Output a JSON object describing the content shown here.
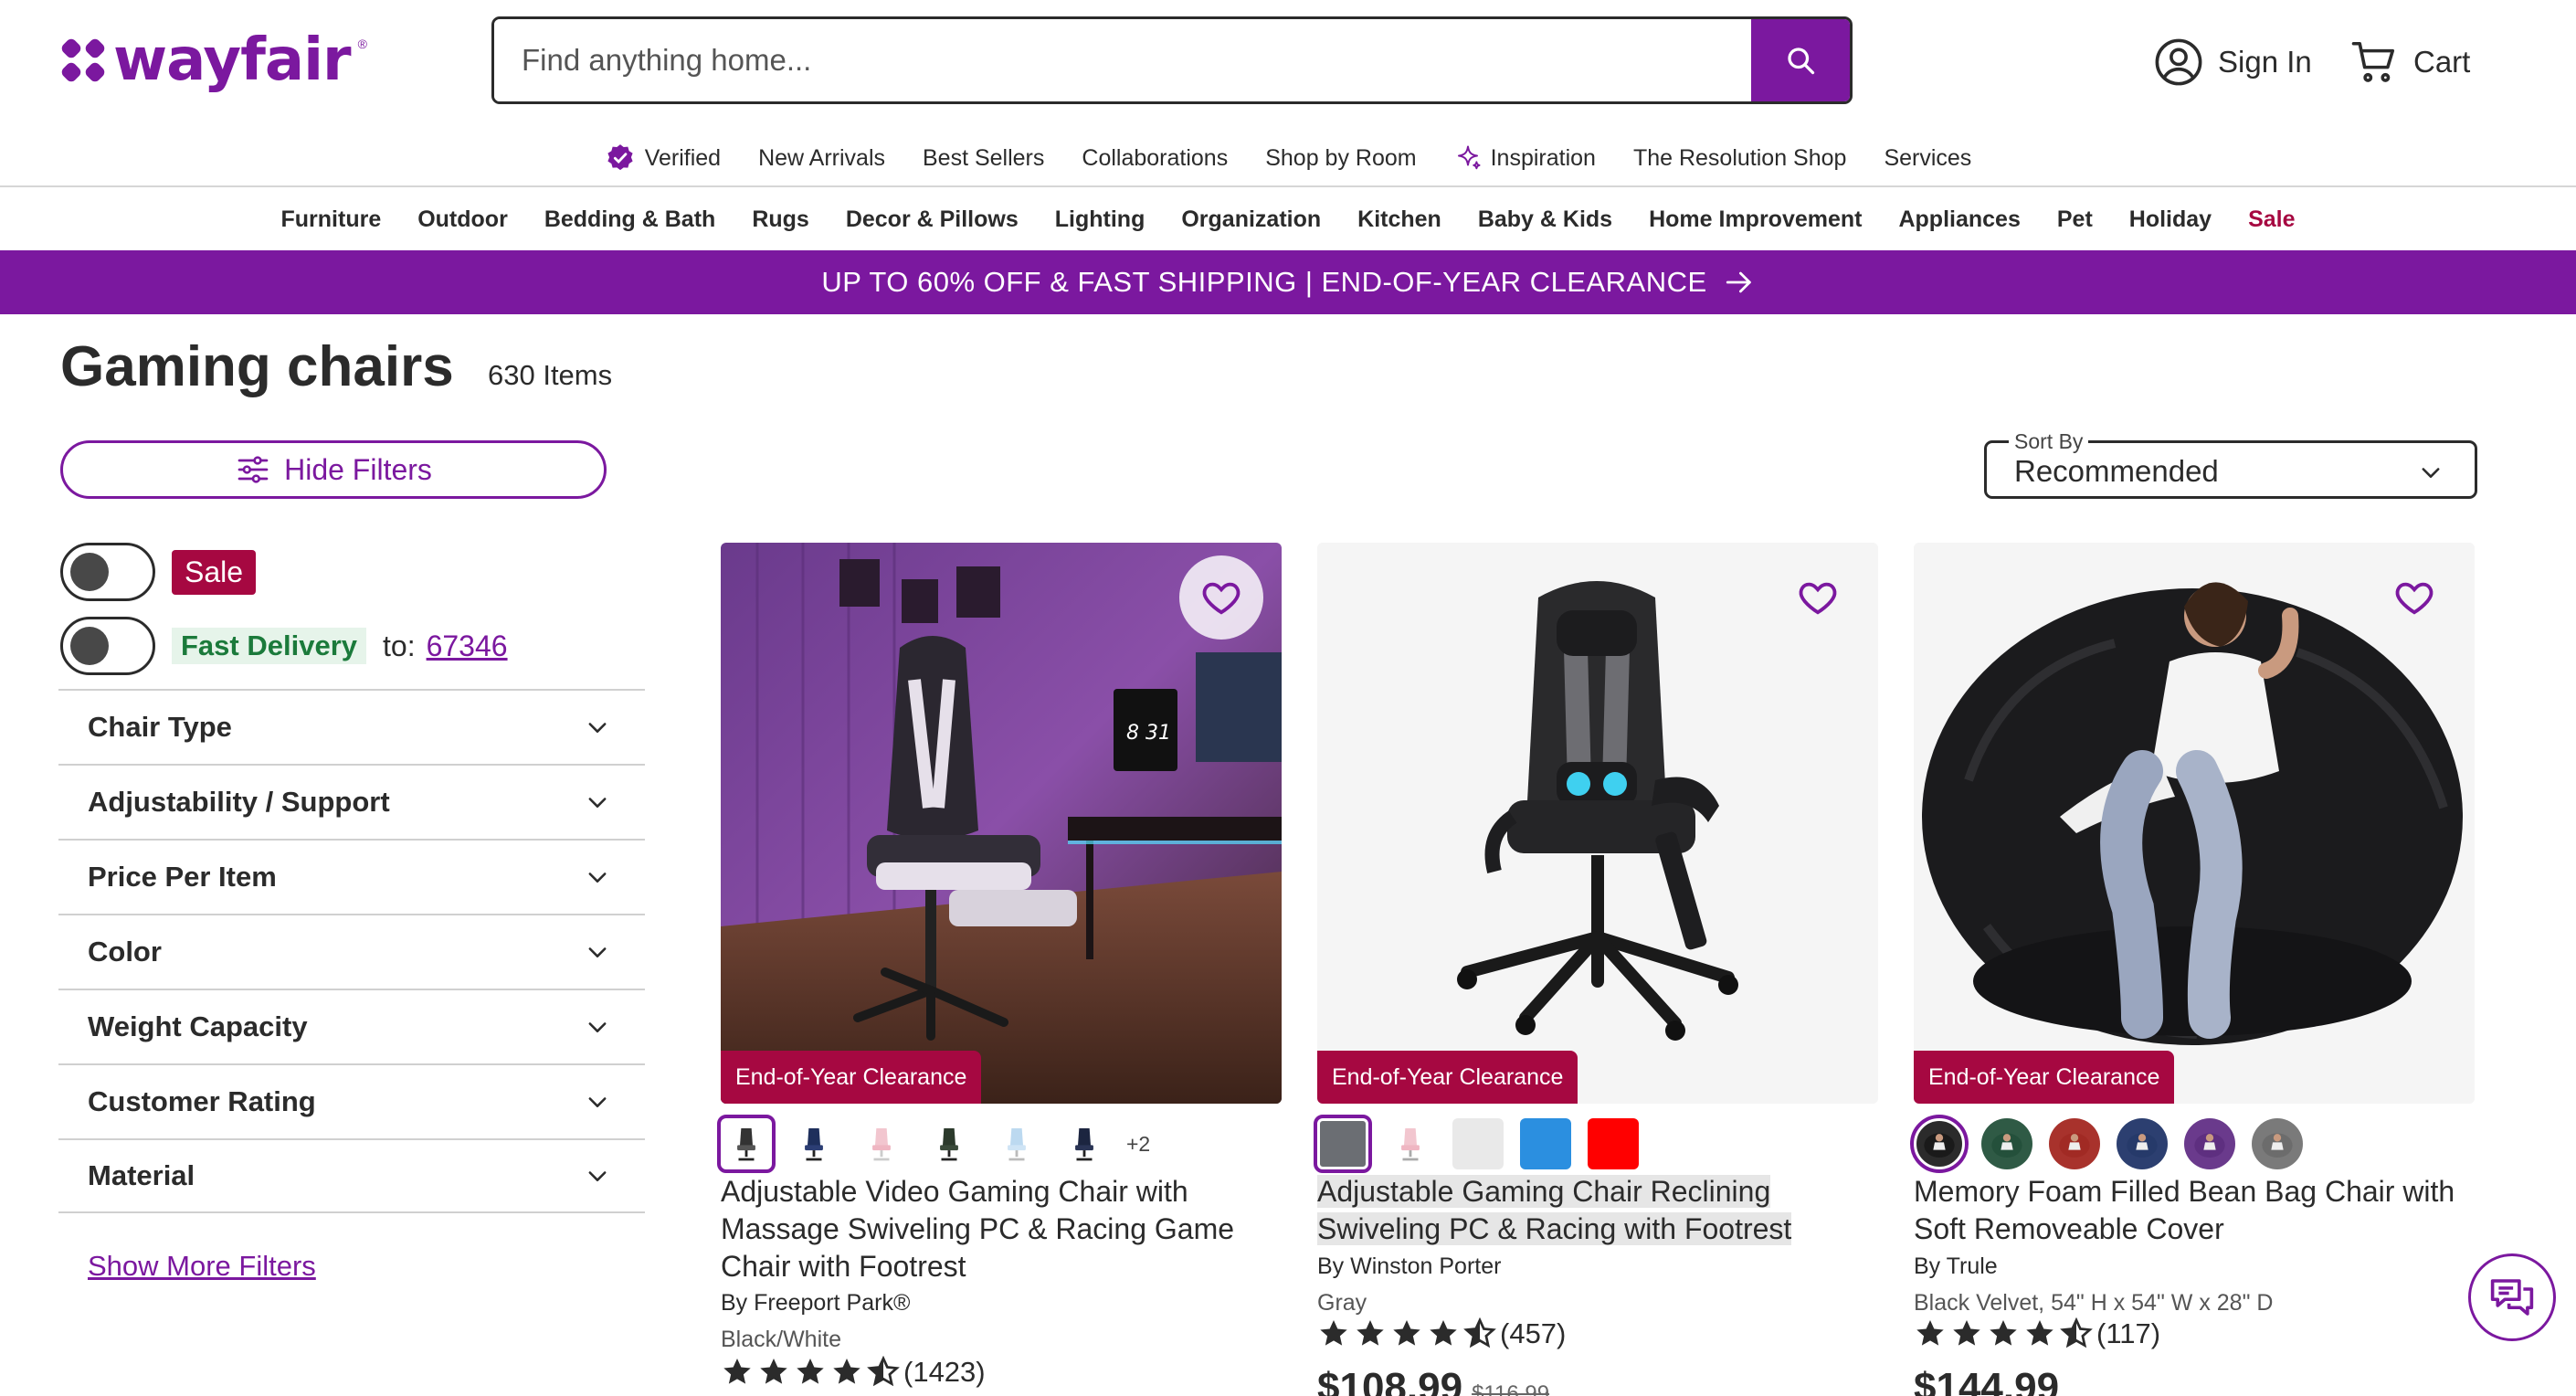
{
  "header": {
    "logo_text": "wayfair",
    "search_placeholder": "Find anything home...",
    "sign_in": "Sign In",
    "cart": "Cart"
  },
  "subnav": [
    "Verified",
    "New Arrivals",
    "Best Sellers",
    "Collaborations",
    "Shop by Room",
    "Inspiration",
    "The Resolution Shop",
    "Services"
  ],
  "categories": [
    "Furniture",
    "Outdoor",
    "Bedding & Bath",
    "Rugs",
    "Decor & Pillows",
    "Lighting",
    "Organization",
    "Kitchen",
    "Baby & Kids",
    "Home Improvement",
    "Appliances",
    "Pet",
    "Holiday",
    "Sale"
  ],
  "promo": "UP TO 60% OFF & FAST SHIPPING | END-OF-YEAR CLEARANCE",
  "page": {
    "title": "Gaming chairs",
    "count": "630 Items"
  },
  "filters": {
    "hide_label": "Hide Filters",
    "sale_label": "Sale",
    "fast_delivery": "Fast Delivery",
    "to_label": "to:",
    "zip": "67346",
    "items": [
      "Chair Type",
      "Adjustability / Support",
      "Price Per Item",
      "Color",
      "Weight Capacity",
      "Customer Rating",
      "Material"
    ],
    "show_more": "Show More Filters"
  },
  "sort": {
    "label": "Sort By",
    "value": "Recommended"
  },
  "colors": {
    "brand": "#7b189f",
    "sale": "#a60841"
  },
  "products": [
    {
      "badge": "End-of-Year Clearance",
      "swatch_more": "+2",
      "name": "Adjustable Video Gaming Chair with Massage Swiveling PC & Racing Game Chair with Footrest",
      "by": "By Freeport Park®",
      "option": "Black/White",
      "rating": 4.5,
      "reviews": "(1423)"
    },
    {
      "badge": "End-of-Year Clearance",
      "name": "Adjustable Gaming Chair Reclining Swiveling PC & Racing with Footrest",
      "by": "By Winston Porter",
      "option": "Gray",
      "rating": 4.5,
      "reviews": "(457)",
      "price": "$108.99",
      "was_price": "$116.99"
    },
    {
      "badge": "End-of-Year Clearance",
      "name": "Memory Foam Filled Bean Bag Chair with Soft Removeable Cover",
      "by": "By Trule",
      "option": "Black Velvet, 54\" H x 54\" W x 28\" D",
      "rating": 4.5,
      "reviews": "(117)",
      "price": "$144.99"
    }
  ]
}
